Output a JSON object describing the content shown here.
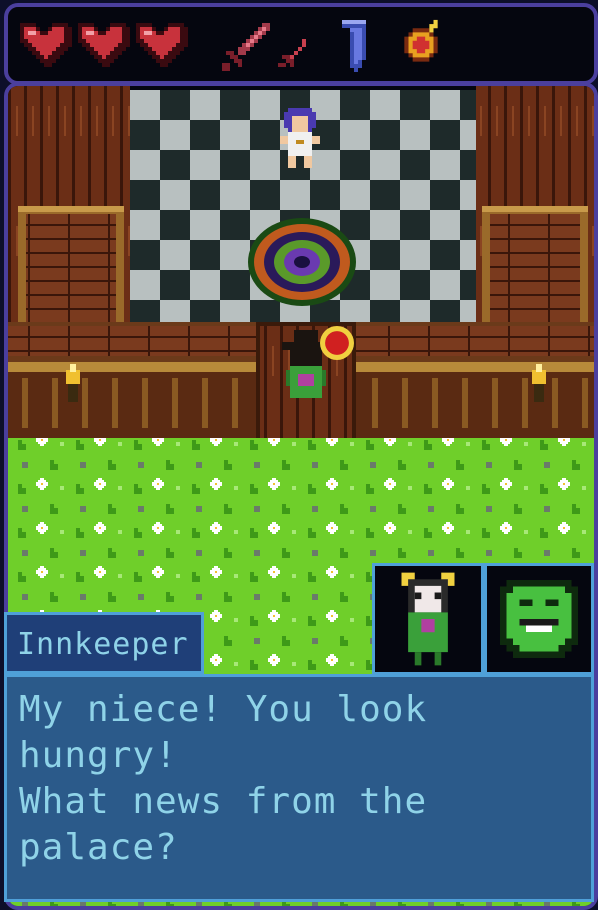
{
  "hud": {
    "hearts": [
      "heart-full",
      "heart-full",
      "heart-full"
    ],
    "items": [
      "sword-icon",
      "dagger-icon",
      "shield-icon",
      "amulet-icon"
    ],
    "colors": {
      "heart": "#c8323c",
      "heart_outline": "#3a0a10",
      "frame": "#4b3f9e"
    }
  },
  "scene": {
    "characters": [
      "princess-npc",
      "innkeeper-npc",
      "player-character"
    ],
    "colors": {
      "checker_light": "#b8c0c0",
      "checker_dark": "#1e2a2a",
      "grass": "#6fcf2a",
      "wood": "#7a3a1e"
    }
  },
  "dialog": {
    "speaker": "Innkeeper",
    "text": "My niece! You look hungry!\nWhat news from the\npalace?",
    "portraits": [
      "player-portrait",
      "innkeeper-portrait"
    ],
    "colors": {
      "box": "#2b5a8a",
      "border": "#4fa0d8",
      "text": "#8fd3e8"
    }
  }
}
